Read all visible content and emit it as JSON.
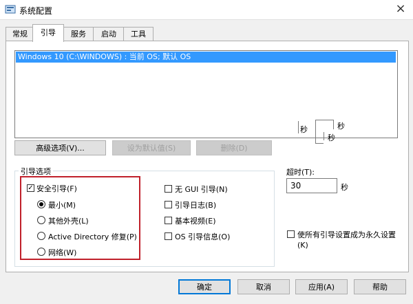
{
  "window": {
    "title": "系统配置",
    "close_icon": "×"
  },
  "tabs": [
    {
      "label": "常规"
    },
    {
      "label": "引导"
    },
    {
      "label": "服务"
    },
    {
      "label": "启动"
    },
    {
      "label": "工具"
    }
  ],
  "os_list": {
    "entries": [
      "Windows 10 (C:\\WINDOWS) : 当前 OS; 默认 OS"
    ]
  },
  "glitch_labels": [
    "秒",
    "秒",
    "秒"
  ],
  "buttons": {
    "advanced": "高级选项(V)...",
    "set_default": "设为默认值(S)",
    "delete": "删除(D)"
  },
  "boot_options": {
    "title": "引导选项",
    "safe_boot": {
      "label": "安全引导(F)",
      "checked": true
    },
    "radios": [
      {
        "label": "最小(M)",
        "selected": true
      },
      {
        "label": "其他外壳(L)",
        "selected": false
      },
      {
        "label": "Active Directory 修复(P)",
        "selected": false
      },
      {
        "label": "网络(W)",
        "selected": false
      }
    ],
    "right_checks": [
      {
        "label": "无 GUI 引导(N)",
        "checked": false
      },
      {
        "label": "引导日志(B)",
        "checked": false
      },
      {
        "label": "基本视频(E)",
        "checked": false
      },
      {
        "label": "OS 引导信息(O)",
        "checked": false
      }
    ]
  },
  "timeout": {
    "label": "超时(T):",
    "value": "30",
    "unit": "秒"
  },
  "permanent": {
    "line1": "使所有引导设置成为永久设置",
    "line2": "(K)",
    "checked": false
  },
  "footer": {
    "ok": "确定",
    "cancel": "取消",
    "apply": "应用(A)",
    "help": "帮助"
  },
  "colors": {
    "accent": "#0078d7",
    "selection": "#3399ff",
    "highlight_box": "#c0202a"
  }
}
